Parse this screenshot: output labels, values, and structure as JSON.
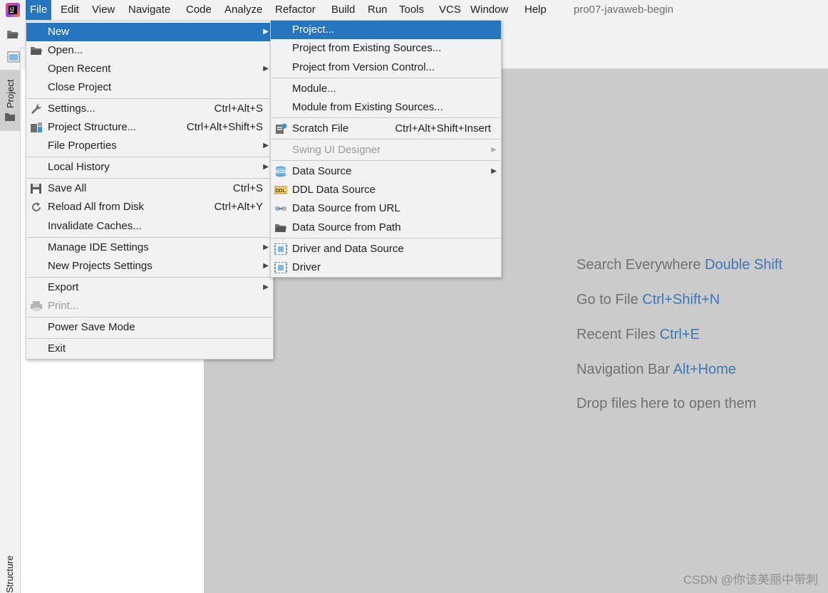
{
  "menubar": {
    "items": [
      "File",
      "Edit",
      "View",
      "Navigate",
      "Code",
      "Analyze",
      "Refactor",
      "Build",
      "Run",
      "Tools",
      "VCS",
      "Window",
      "Help"
    ],
    "window_title": "pro07-javaweb-begin"
  },
  "tool_windows": {
    "project_tab": "Project",
    "structure_tab": "Structure"
  },
  "file_menu": {
    "items": [
      {
        "label": "New"
      },
      {
        "label": "Open..."
      },
      {
        "label": "Open Recent"
      },
      {
        "label": "Close Project"
      },
      {
        "label": "Settings...",
        "shortcut": "Ctrl+Alt+S"
      },
      {
        "label": "Project Structure...",
        "shortcut": "Ctrl+Alt+Shift+S"
      },
      {
        "label": "File Properties"
      },
      {
        "label": "Local History"
      },
      {
        "label": "Save All",
        "shortcut": "Ctrl+S"
      },
      {
        "label": "Reload All from Disk",
        "shortcut": "Ctrl+Alt+Y"
      },
      {
        "label": "Invalidate Caches..."
      },
      {
        "label": "Manage IDE Settings"
      },
      {
        "label": "New Projects Settings"
      },
      {
        "label": "Export"
      },
      {
        "label": "Print..."
      },
      {
        "label": "Power Save Mode"
      },
      {
        "label": "Exit"
      }
    ]
  },
  "new_submenu": {
    "items": [
      {
        "label": "Project..."
      },
      {
        "label": "Project from Existing Sources..."
      },
      {
        "label": "Project from Version Control..."
      },
      {
        "label": "Module..."
      },
      {
        "label": "Module from Existing Sources..."
      },
      {
        "label": "Scratch File",
        "shortcut": "Ctrl+Alt+Shift+Insert"
      },
      {
        "label": "Swing UI Designer"
      },
      {
        "label": "Data Source"
      },
      {
        "label": "DDL Data Source"
      },
      {
        "label": "Data Source from URL"
      },
      {
        "label": "Data Source from Path"
      },
      {
        "label": "Driver and Data Source"
      },
      {
        "label": "Driver"
      }
    ]
  },
  "editor_hints": [
    {
      "text": "Search Everywhere",
      "key": "Double Shift"
    },
    {
      "text": "Go to File",
      "key": "Ctrl+Shift+N"
    },
    {
      "text": "Recent Files",
      "key": "Ctrl+E"
    },
    {
      "text": "Navigation Bar",
      "key": "Alt+Home"
    },
    {
      "text": "Drop files here to open them",
      "key": ""
    }
  ],
  "watermark": "CSDN @你该美丽中带刺",
  "colors": {
    "selection": "#2675bf",
    "hint_key": "#3c78b4",
    "editor_bg": "#cbcbcb"
  }
}
